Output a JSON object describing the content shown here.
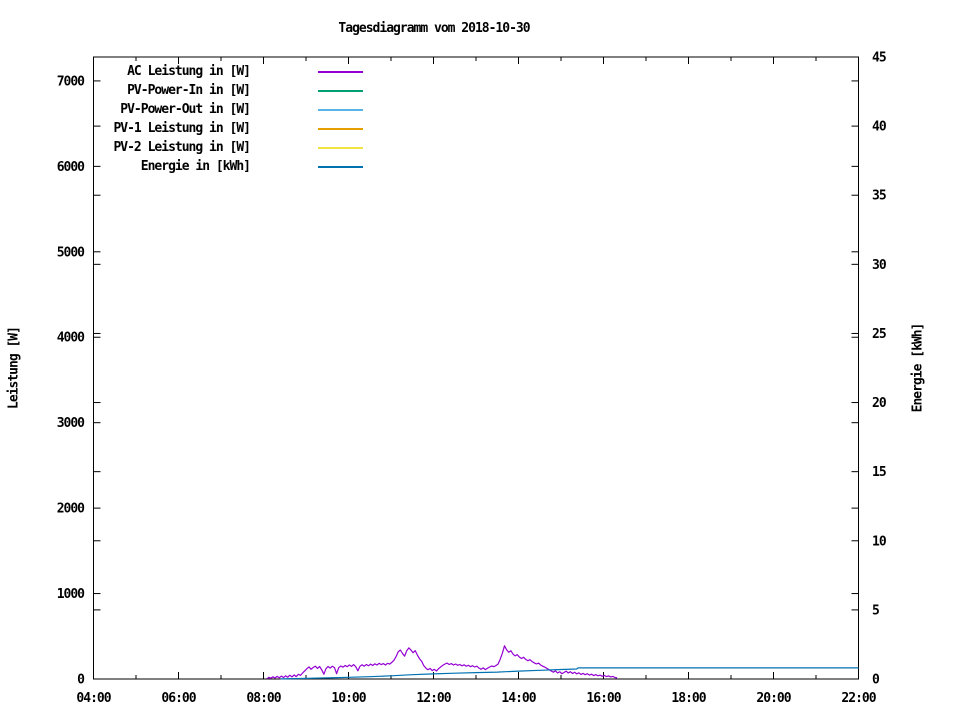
{
  "chart_data": {
    "type": "line",
    "title": "Tagesdiagramm vom 2018-10-30",
    "y1_label": "Leistung [W]",
    "y2_label": "Energie [kWh]",
    "x_unit": "time of day (hours)",
    "x_range_hours": [
      4,
      22
    ],
    "y1_range": [
      0,
      7280
    ],
    "y2_range": [
      0,
      45
    ],
    "y1_ticks": [
      0,
      1000,
      2000,
      3000,
      4000,
      5000,
      6000,
      7000
    ],
    "y2_ticks": [
      0,
      5,
      10,
      15,
      20,
      25,
      30,
      35,
      40,
      45
    ],
    "x_major_ticks": [
      {
        "hour": 4,
        "label": "04:00"
      },
      {
        "hour": 6,
        "label": "06:00"
      },
      {
        "hour": 8,
        "label": "08:00"
      },
      {
        "hour": 10,
        "label": "10:00"
      },
      {
        "hour": 12,
        "label": "12:00"
      },
      {
        "hour": 14,
        "label": "14:00"
      },
      {
        "hour": 16,
        "label": "16:00"
      },
      {
        "hour": 18,
        "label": "18:00"
      },
      {
        "hour": 20,
        "label": "20:00"
      },
      {
        "hour": 22,
        "label": "22:00"
      }
    ],
    "x_minor_hours": [
      5,
      7,
      9,
      11,
      13,
      15,
      17,
      19,
      21
    ],
    "grid": false,
    "legend_position": "top-left-inside",
    "background_color": "#ffffff",
    "axis_color": "#000000",
    "series": [
      {
        "label": "AC Leistung in [W]",
        "color": "#9400d3",
        "axis": "y1",
        "points": [
          [
            8.08,
            3
          ],
          [
            8.13,
            20
          ],
          [
            8.17,
            8
          ],
          [
            8.22,
            26
          ],
          [
            8.27,
            12
          ],
          [
            8.32,
            30
          ],
          [
            8.37,
            14
          ],
          [
            8.42,
            34
          ],
          [
            8.47,
            18
          ],
          [
            8.52,
            38
          ],
          [
            8.57,
            20
          ],
          [
            8.62,
            44
          ],
          [
            8.67,
            24
          ],
          [
            8.72,
            48
          ],
          [
            8.77,
            28
          ],
          [
            8.82,
            55
          ],
          [
            8.87,
            42
          ],
          [
            8.92,
            70
          ],
          [
            8.97,
            95
          ],
          [
            9.02,
            120
          ],
          [
            9.07,
            142
          ],
          [
            9.12,
            114
          ],
          [
            9.17,
            136
          ],
          [
            9.22,
            150
          ],
          [
            9.27,
            124
          ],
          [
            9.32,
            146
          ],
          [
            9.37,
            108
          ],
          [
            9.42,
            56
          ],
          [
            9.47,
            122
          ],
          [
            9.52,
            146
          ],
          [
            9.57,
            128
          ],
          [
            9.62,
            150
          ],
          [
            9.67,
            134
          ],
          [
            9.72,
            62
          ],
          [
            9.77,
            132
          ],
          [
            9.82,
            152
          ],
          [
            9.87,
            138
          ],
          [
            9.92,
            158
          ],
          [
            9.97,
            144
          ],
          [
            10.02,
            164
          ],
          [
            10.07,
            148
          ],
          [
            10.12,
            168
          ],
          [
            10.17,
            144
          ],
          [
            10.22,
            96
          ],
          [
            10.27,
            150
          ],
          [
            10.32,
            166
          ],
          [
            10.37,
            150
          ],
          [
            10.42,
            170
          ],
          [
            10.47,
            154
          ],
          [
            10.52,
            174
          ],
          [
            10.57,
            158
          ],
          [
            10.62,
            178
          ],
          [
            10.67,
            164
          ],
          [
            10.72,
            184
          ],
          [
            10.77,
            168
          ],
          [
            10.82,
            180
          ],
          [
            10.87,
            164
          ],
          [
            10.92,
            184
          ],
          [
            10.97,
            174
          ],
          [
            11.02,
            194
          ],
          [
            11.07,
            220
          ],
          [
            11.12,
            262
          ],
          [
            11.17,
            318
          ],
          [
            11.22,
            340
          ],
          [
            11.27,
            298
          ],
          [
            11.32,
            268
          ],
          [
            11.37,
            330
          ],
          [
            11.42,
            364
          ],
          [
            11.47,
            338
          ],
          [
            11.52,
            308
          ],
          [
            11.57,
            332
          ],
          [
            11.62,
            282
          ],
          [
            11.67,
            238
          ],
          [
            11.72,
            208
          ],
          [
            11.77,
            158
          ],
          [
            11.82,
            128
          ],
          [
            11.87,
            108
          ],
          [
            11.92,
            124
          ],
          [
            11.97,
            98
          ],
          [
            12.02,
            114
          ],
          [
            12.07,
            94
          ],
          [
            12.12,
            120
          ],
          [
            12.17,
            142
          ],
          [
            12.22,
            160
          ],
          [
            12.27,
            176
          ],
          [
            12.32,
            186
          ],
          [
            12.37,
            170
          ],
          [
            12.42,
            180
          ],
          [
            12.47,
            164
          ],
          [
            12.52,
            176
          ],
          [
            12.57,
            160
          ],
          [
            12.62,
            170
          ],
          [
            12.67,
            154
          ],
          [
            12.72,
            166
          ],
          [
            12.77,
            150
          ],
          [
            12.82,
            160
          ],
          [
            12.87,
            144
          ],
          [
            12.92,
            156
          ],
          [
            12.97,
            140
          ],
          [
            13.02,
            150
          ],
          [
            13.07,
            128
          ],
          [
            13.12,
            114
          ],
          [
            13.17,
            130
          ],
          [
            13.22,
            110
          ],
          [
            13.27,
            126
          ],
          [
            13.32,
            140
          ],
          [
            13.37,
            152
          ],
          [
            13.42,
            144
          ],
          [
            13.47,
            158
          ],
          [
            13.52,
            176
          ],
          [
            13.57,
            232
          ],
          [
            13.62,
            300
          ],
          [
            13.67,
            388
          ],
          [
            13.72,
            342
          ],
          [
            13.77,
            312
          ],
          [
            13.82,
            330
          ],
          [
            13.87,
            292
          ],
          [
            13.92,
            270
          ],
          [
            13.97,
            286
          ],
          [
            14.02,
            258
          ],
          [
            14.07,
            240
          ],
          [
            14.12,
            254
          ],
          [
            14.17,
            230
          ],
          [
            14.22,
            214
          ],
          [
            14.27,
            226
          ],
          [
            14.32,
            204
          ],
          [
            14.37,
            190
          ],
          [
            14.42,
            176
          ],
          [
            14.47,
            186
          ],
          [
            14.52,
            164
          ],
          [
            14.57,
            150
          ],
          [
            14.62,
            138
          ],
          [
            14.67,
            124
          ],
          [
            14.72,
            108
          ],
          [
            14.77,
            94
          ],
          [
            14.82,
            80
          ],
          [
            14.87,
            96
          ],
          [
            14.92,
            70
          ],
          [
            14.97,
            86
          ],
          [
            15.02,
            62
          ],
          [
            15.07,
            76
          ],
          [
            15.12,
            92
          ],
          [
            15.17,
            70
          ],
          [
            15.22,
            86
          ],
          [
            15.27,
            64
          ],
          [
            15.32,
            80
          ],
          [
            15.37,
            60
          ],
          [
            15.42,
            72
          ],
          [
            15.47,
            54
          ],
          [
            15.52,
            66
          ],
          [
            15.57,
            50
          ],
          [
            15.62,
            62
          ],
          [
            15.67,
            46
          ],
          [
            15.72,
            56
          ],
          [
            15.77,
            40
          ],
          [
            15.82,
            52
          ],
          [
            15.87,
            38
          ],
          [
            15.92,
            46
          ],
          [
            15.97,
            32
          ],
          [
            16.02,
            42
          ],
          [
            16.07,
            28
          ],
          [
            16.12,
            36
          ],
          [
            16.17,
            24
          ],
          [
            16.22,
            30
          ],
          [
            16.27,
            18
          ],
          [
            16.32,
            12
          ]
        ]
      },
      {
        "label": "PV-Power-In in [W]",
        "color": "#009e73",
        "axis": "y1",
        "points": []
      },
      {
        "label": "PV-Power-Out in [W]",
        "color": "#56b4e9",
        "axis": "y1",
        "points": []
      },
      {
        "label": "PV-1 Leistung in [W]",
        "color": "#e69f00",
        "axis": "y1",
        "points": []
      },
      {
        "label": "PV-2 Leistung in [W]",
        "color": "#f0e442",
        "axis": "y1",
        "points": []
      },
      {
        "label": "Energie in [kWh]",
        "color": "#0072b2",
        "axis": "y2",
        "points": [
          [
            8.4,
            0.01
          ],
          [
            9.0,
            0.04
          ],
          [
            9.5,
            0.08
          ],
          [
            10.0,
            0.12
          ],
          [
            10.5,
            0.17
          ],
          [
            11.0,
            0.23
          ],
          [
            11.5,
            0.31
          ],
          [
            12.0,
            0.37
          ],
          [
            12.5,
            0.42
          ],
          [
            13.0,
            0.46
          ],
          [
            13.5,
            0.5
          ],
          [
            13.7,
            0.53
          ],
          [
            14.0,
            0.57
          ],
          [
            14.5,
            0.63
          ],
          [
            15.0,
            0.69
          ],
          [
            15.37,
            0.72
          ],
          [
            15.4,
            0.8
          ],
          [
            16.0,
            0.8
          ],
          [
            22.0,
            0.8
          ]
        ]
      }
    ]
  }
}
